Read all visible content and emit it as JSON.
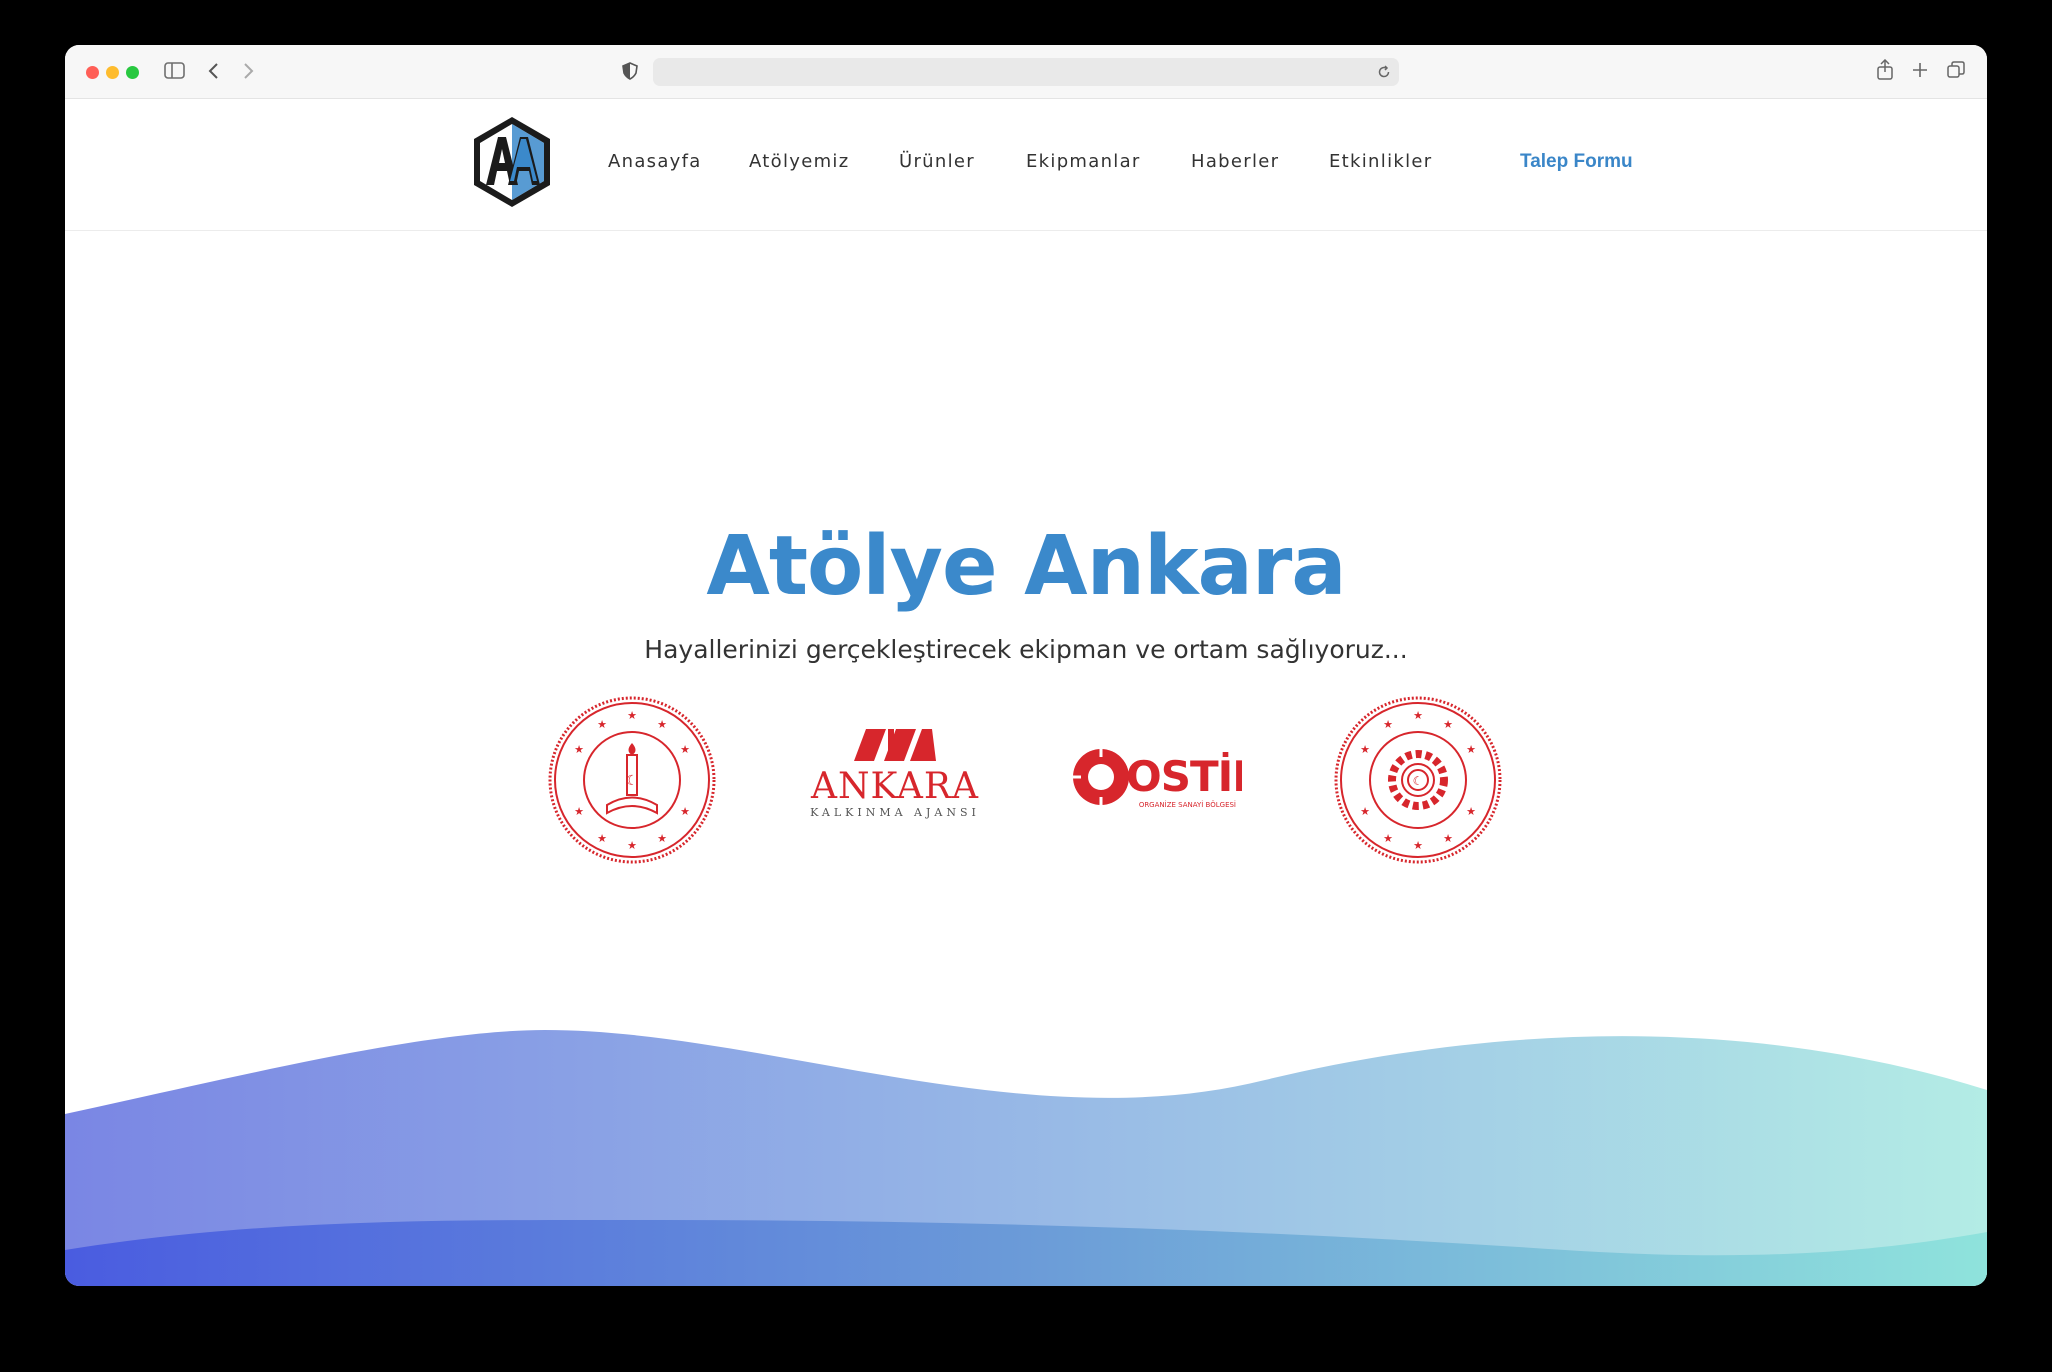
{
  "browser": {
    "traffic_lights": [
      "#ff5f57",
      "#febc2e",
      "#28c840"
    ],
    "toolbar_icons": [
      "sidebar-icon",
      "back-icon",
      "forward-icon",
      "shield-icon",
      "reload-icon",
      "share-icon",
      "new-tab-icon",
      "tabs-overview-icon"
    ],
    "url": ""
  },
  "nav": {
    "links": [
      "Anasayfa",
      "Atölyemiz",
      "Ürünler",
      "Ekipmanlar",
      "Haberler",
      "Etkinlikler"
    ],
    "cta": "Talep Formu"
  },
  "hero": {
    "title": "Atölye Ankara",
    "subtitle": "Hayallerinizi gerçekleştirecek ekipman ve ortam sağlıyoruz..."
  },
  "partners": [
    {
      "name": "milli-egitim-seal",
      "seal_text": "TÜRKİYE CUMHURİYETİ MİLLİ EĞİTİM BAKANLIĞI"
    },
    {
      "name": "ankara-kalkinma-ajansi-logo",
      "wordmark": "ANKARA",
      "subtext": "KALKINMA AJANSI"
    },
    {
      "name": "ostim-logo",
      "wordmark": "OSTİM",
      "subtext": "ORGANİZE SANAYİ BÖLGESİ"
    },
    {
      "name": "sanayi-teknoloji-seal",
      "seal_text": "TÜRKİYE CUMHURİYETİ SANAYİ VE TEKNOLOJİ BAKANLIĞI"
    }
  ],
  "colors": {
    "accent": "#3b89cb",
    "partner_red": "#d7262c",
    "wave_start": "#4a5ce0",
    "wave_end": "#8fe3dc"
  }
}
